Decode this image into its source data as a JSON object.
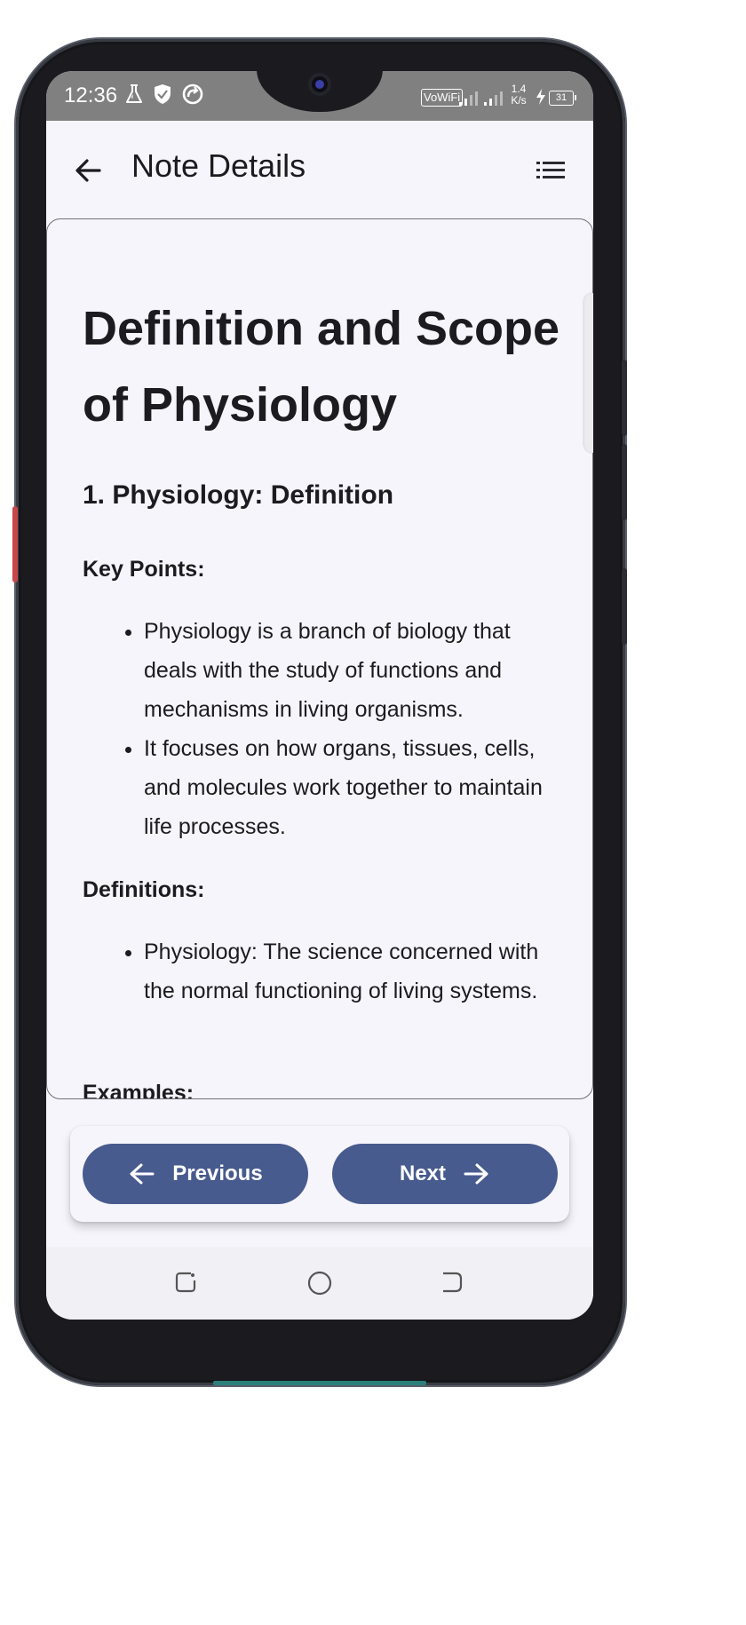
{
  "status_bar": {
    "time": "12:36",
    "left_icons": [
      "flask-icon",
      "shield-icon",
      "sync-icon"
    ],
    "wifi_label": "VoWiFi",
    "speed_value": "1.4",
    "speed_unit": "K/s",
    "battery": "31"
  },
  "app_bar": {
    "title": "Note Details",
    "back_icon": "arrow-left-icon",
    "menu_icon": "list-icon"
  },
  "note": {
    "title": "Definition and Scope of Physiology",
    "section_heading": "1. Physiology: Definition",
    "key_points_label": "Key Points:",
    "key_points": [
      "Physiology is a branch of biology that deals with the study of functions and mechanisms in living organisms.",
      "It focuses on how organs, tissues, cells, and molecules work together to maintain life processes."
    ],
    "definitions_label": "Definitions:",
    "definitions": [
      "Physiology: The science concerned with the normal functioning of living systems."
    ],
    "examples_label": "Examples:"
  },
  "navigation": {
    "previous_label": "Previous",
    "next_label": "Next"
  },
  "colors": {
    "button_bg": "#485b8f",
    "page_bg": "#f6f5fb",
    "text": "#1c1b1f"
  }
}
